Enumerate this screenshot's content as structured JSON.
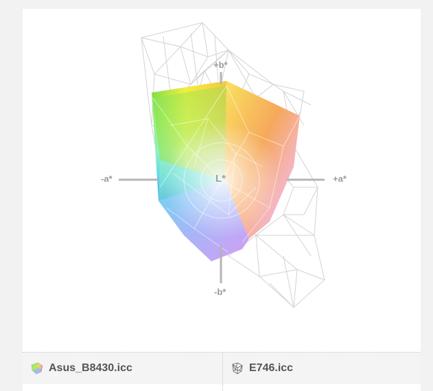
{
  "axes": {
    "plus_b": "+b*",
    "minus_b": "-b*",
    "minus_a": "-a*",
    "plus_a": "+a*",
    "l": "L*"
  },
  "legend": {
    "profile_1": "Asus_B8430.icc",
    "profile_2": "E746.icc"
  },
  "icons": {
    "profile_1": "color-gamut-icon",
    "profile_2": "wireframe-gamut-icon"
  },
  "colors": {
    "axis": "#b4b4b4",
    "wireframe": "#cfcfcf"
  }
}
